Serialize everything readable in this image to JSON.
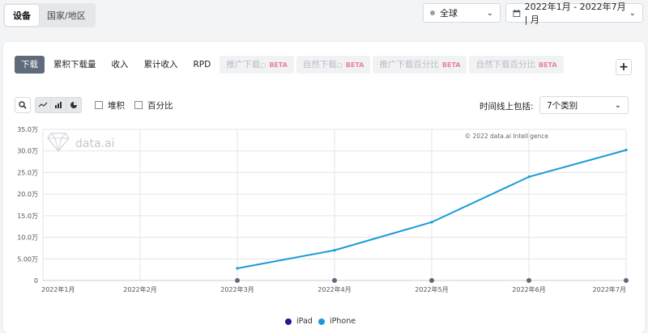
{
  "segment": {
    "device": "设备",
    "country": "国家/地区"
  },
  "region_dropdown": {
    "value": "全球"
  },
  "date_dropdown": {
    "value": "2022年1月 - 2022年7月 | 月"
  },
  "tabs": [
    {
      "label": "下载",
      "active": true,
      "disabled": false
    },
    {
      "label": "累积下载量",
      "active": false,
      "disabled": false
    },
    {
      "label": "收入",
      "active": false,
      "disabled": false
    },
    {
      "label": "累计收入",
      "active": false,
      "disabled": false
    },
    {
      "label": "RPD",
      "active": false,
      "disabled": false
    },
    {
      "label": "推广下载",
      "active": false,
      "disabled": true,
      "beta": "BETA"
    },
    {
      "label": "自然下载",
      "active": false,
      "disabled": true,
      "beta": "BETA"
    },
    {
      "label": "推广下载百分比",
      "active": false,
      "disabled": true,
      "beta": "BETA"
    },
    {
      "label": "自然下载百分比",
      "active": false,
      "disabled": true,
      "beta": "BETA"
    }
  ],
  "toolbar": {
    "stacked_label": "堆积",
    "percent_label": "百分比",
    "include_label": "时间线上包括:",
    "category_value": "7个类别"
  },
  "watermark": {
    "logo_text": "data.ai",
    "copyright": "© 2022 data.ai Intelligence"
  },
  "colors": {
    "iphone": "#1a9ad8",
    "ipad": "#1f1c8c",
    "grid": "#e3e5e8",
    "marker": "#5f6b7a"
  },
  "chart_data": {
    "type": "line",
    "categories": [
      "2022年1月",
      "2022年2月",
      "2022年3月",
      "2022年4月",
      "2022年5月",
      "2022年6月",
      "2022年7月"
    ],
    "y_ticks": [
      "0",
      "5.00万",
      "10.0万",
      "15.0万",
      "20.0万",
      "25.0万",
      "30.0万",
      "35.0万"
    ],
    "ylim": [
      0,
      350000
    ],
    "series": [
      {
        "name": "iPad",
        "values": [
          null,
          null,
          null,
          null,
          null,
          null,
          null
        ]
      },
      {
        "name": "iPhone",
        "values": [
          null,
          null,
          28000,
          70000,
          135000,
          240000,
          302000
        ]
      }
    ],
    "legend_position": "bottom-center",
    "grid": true
  }
}
